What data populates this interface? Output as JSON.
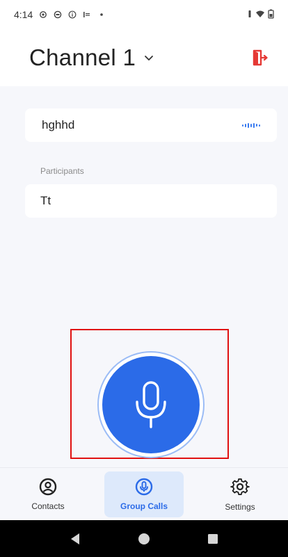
{
  "status_bar": {
    "time": "4:14",
    "icons": [
      "settings-gear-icon",
      "circle-icon",
      "info-icon",
      "signal-bars-icon",
      "dot-icon"
    ],
    "right_icons": [
      "vibrate-icon",
      "wifi-icon",
      "battery-icon"
    ]
  },
  "header": {
    "title": "Channel 1",
    "exit_icon": "exit-door-icon",
    "accent": "#e53935"
  },
  "speaker": {
    "name": "hghhd",
    "indicator": "audio-wave-icon"
  },
  "participants": {
    "label": "Participants",
    "items": [
      "Tt"
    ]
  },
  "mic": {
    "icon": "microphone-icon",
    "color": "#2b6be8"
  },
  "bottom_nav": {
    "items": [
      {
        "label": "Contacts",
        "icon": "contact-icon",
        "active": false
      },
      {
        "label": "Group Calls",
        "icon": "mic-circle-icon",
        "active": true
      },
      {
        "label": "Settings",
        "icon": "gear-icon",
        "active": false
      }
    ]
  },
  "system_nav": {
    "buttons": [
      "back-icon",
      "home-icon",
      "recents-icon"
    ]
  }
}
